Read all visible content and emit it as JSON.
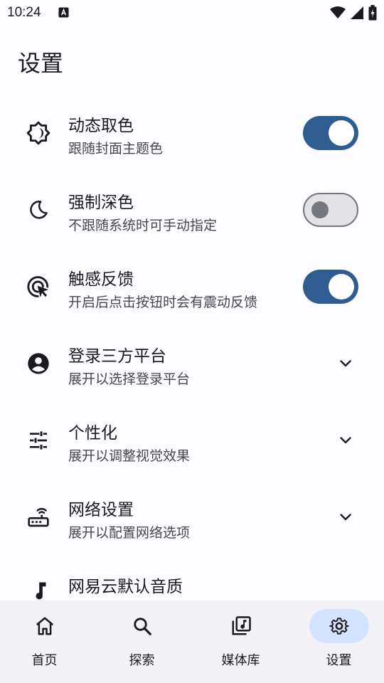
{
  "status_bar": {
    "time": "10:24",
    "notification_icon": "a-badge-icon",
    "wifi_icon": "wifi-icon",
    "signal_icon": "signal-icon",
    "battery_icon": "battery-charging-icon"
  },
  "page": {
    "title": "设置"
  },
  "settings": [
    {
      "icon": "brightness-auto-icon",
      "title": "动态取色",
      "subtitle": "跟随封面主题色",
      "control": "toggle",
      "checked": true
    },
    {
      "icon": "moon-icon",
      "title": "强制深色",
      "subtitle": "不跟随系统时可手动指定",
      "control": "toggle",
      "checked": false
    },
    {
      "icon": "touch-target-icon",
      "title": "触感反馈",
      "subtitle": "开启后点击按钮时会有震动反馈",
      "control": "toggle",
      "checked": true
    },
    {
      "icon": "account-circle-icon",
      "title": "登录三方平台",
      "subtitle": "展开以选择登录平台",
      "control": "expand"
    },
    {
      "icon": "sliders-icon",
      "title": "个性化",
      "subtitle": "展开以调整视觉效果",
      "control": "expand"
    },
    {
      "icon": "router-icon",
      "title": "网络设置",
      "subtitle": "展开以配置网络选项",
      "control": "expand"
    },
    {
      "icon": "music-note-icon",
      "title": "网易云默认音质",
      "subtitle": "",
      "control": "none"
    }
  ],
  "bottom_nav": {
    "items": [
      {
        "label": "首页",
        "icon": "home-icon",
        "active": false
      },
      {
        "label": "探索",
        "icon": "search-icon",
        "active": false
      },
      {
        "label": "媒体库",
        "icon": "library-music-icon",
        "active": false
      },
      {
        "label": "设置",
        "icon": "gear-icon",
        "active": true
      }
    ]
  },
  "colors": {
    "accent": "#2f5d91",
    "active_nav_pill": "#d4e3ff",
    "nav_background": "#f2f2f7",
    "text_primary": "#1b1b1f",
    "text_secondary": "#45464f"
  }
}
